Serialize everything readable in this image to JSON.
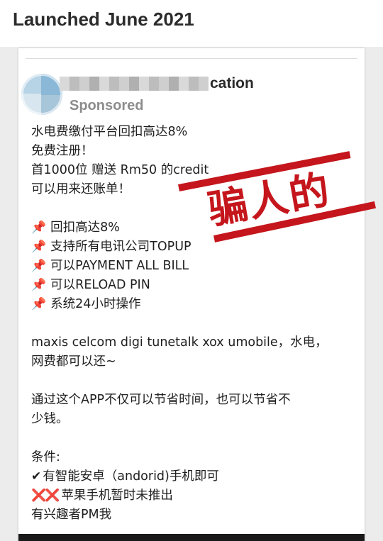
{
  "header": {
    "title": "Launched June 2021"
  },
  "post": {
    "advertiser_visible": "cation",
    "sponsored_label": "Sponsored",
    "lines": [
      "水电费缴付平台回扣高达8%",
      "免费注册！",
      "首1000位 赠送 Rm50 的credit",
      "可以用来还账单！"
    ],
    "bullets": [
      "回扣高达8%",
      "支持所有电讯公司TOPUP",
      "可以PAYMENT ALL BILL",
      "可以RELOAD PIN",
      "系统24小时操作"
    ],
    "telcos_line1": "maxis celcom digi tunetalk xox umobile，水电，",
    "telcos_line2": "网费都可以还~",
    "savings_line1": "通过这个APP不仅可以节省时间，也可以节省不",
    "savings_line2": "少钱。",
    "conditions_label": "条件:",
    "condition_android": "有智能安卓（andorid)手机即可",
    "condition_apple": "苹果手机暂时未推出",
    "contact": "有兴趣者PM我"
  },
  "stamp": {
    "text": "骗人的",
    "color": "#c4161c"
  },
  "icons": {
    "bullet": "pushpin-icon",
    "check": "check-icon",
    "cross": "cross-icon",
    "pin_glyph": "📌",
    "check_glyph": "✔",
    "cross_glyph": "❌"
  }
}
